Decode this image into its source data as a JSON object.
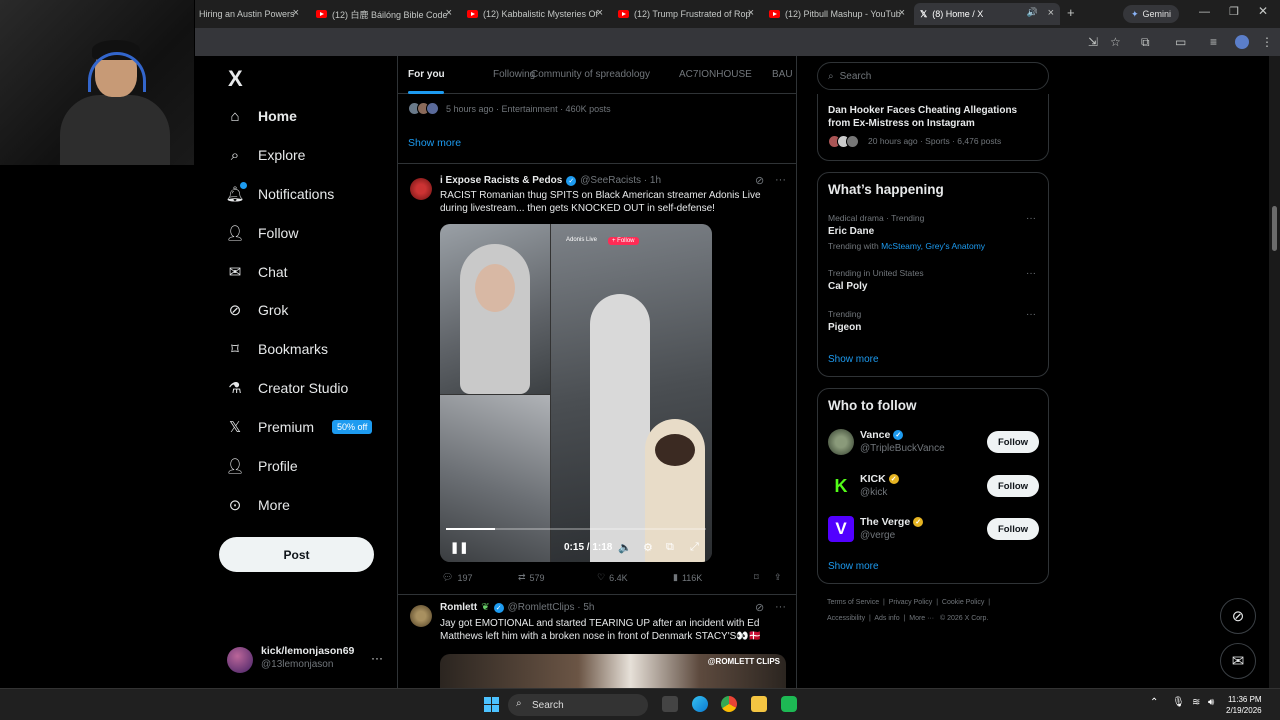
{
  "browser": {
    "tabs": [
      {
        "title": "Hiring an Austin Powers"
      },
      {
        "title": "(12) 白鹿 Báilóng Bible Code"
      },
      {
        "title": "(12) Kabbalistic Mysteries Of"
      },
      {
        "title": "(12) Trump Frustrated of Rop"
      },
      {
        "title": "(12) Pitbull Mashup - YouTub"
      },
      {
        "title": "(8) Home / X"
      }
    ],
    "gemini_label": "Gemini"
  },
  "nav": {
    "logo": "X",
    "items": [
      {
        "label": "Home",
        "icon": "home-icon"
      },
      {
        "label": "Explore",
        "icon": "search-icon"
      },
      {
        "label": "Notifications",
        "icon": "bell-icon"
      },
      {
        "label": "Follow",
        "icon": "person-add-icon"
      },
      {
        "label": "Chat",
        "icon": "mail-icon"
      },
      {
        "label": "Grok",
        "icon": "grok-icon"
      },
      {
        "label": "Bookmarks",
        "icon": "bookmark-icon"
      },
      {
        "label": "Creator Studio",
        "icon": "flask-icon"
      },
      {
        "label": "Premium",
        "icon": "x-icon"
      },
      {
        "label": "Profile",
        "icon": "person-icon"
      },
      {
        "label": "More",
        "icon": "more-circle-icon"
      }
    ],
    "premium_badge": "50% off",
    "post_label": "Post",
    "account": {
      "name": "kick/lemonjason69",
      "handle": "@13lemonjason"
    }
  },
  "timeline": {
    "tabs": [
      "For you",
      "Following",
      "Community of spreadology",
      "AC7IONHOUSE",
      "BAU"
    ],
    "trend_meta": "5 hours ago · Entertainment · 460K posts",
    "show_more": "Show more",
    "tweets": [
      {
        "name": "i Expose Racists & Pedos",
        "handle": "@SeeRacists · 1h",
        "text": "RACIST Romanian thug SPITS on Black American streamer Adonis Live during livestream... then gets KNOCKED OUT in self-defense!",
        "video": {
          "time": "0:15 / 1:18",
          "progress": 0.19,
          "live_label": "Adonis Live",
          "follow_label": "+ Follow"
        },
        "stats": {
          "replies": "197",
          "reposts": "579",
          "likes": "6.4K",
          "views": "116K"
        }
      },
      {
        "name": "Romlett",
        "handle": "@RomlettClips · 5h",
        "text": "Jay got EMOTIONAL and started TEARING UP after an incident with Ed Matthews left him with a broken nose in front of Denmark STACY'S👀🇩🇰",
        "image_label": "@ROMLETT CLIPS"
      }
    ]
  },
  "right": {
    "search_placeholder": "Search",
    "top_trend": {
      "title": "Dan Hooker Faces Cheating Allegations from Ex-Mistress on Instagram",
      "meta": "20 hours ago · Sports · 6,476 posts"
    },
    "happening": {
      "title": "What’s happening",
      "items": [
        {
          "context": "Medical drama · Trending",
          "name": "Eric Dane",
          "extra_prefix": "Trending with",
          "extra": "McSteamy, Grey's Anatomy"
        },
        {
          "context": "Trending in United States",
          "name": "Cal Poly"
        },
        {
          "context": "Trending",
          "name": "Pigeon"
        }
      ],
      "show_more": "Show more"
    },
    "who_to_follow": {
      "title": "Who to follow",
      "accounts": [
        {
          "name": "Vance",
          "handle": "@TripleBuckVance",
          "button": "Follow"
        },
        {
          "name": "KICK",
          "handle": "@kick",
          "button": "Follow"
        },
        {
          "name": "The Verge",
          "handle": "@verge",
          "button": "Follow"
        }
      ],
      "show_more": "Show more"
    },
    "footer": {
      "line1": [
        "Terms of Service",
        "Privacy Policy",
        "Cookie Policy"
      ],
      "line2": [
        "Accessibility",
        "Ads info",
        "More ···",
        "© 2026 X Corp."
      ]
    }
  },
  "taskbar": {
    "search": "Search",
    "time": "11:36 PM",
    "date": "2/19/2026"
  },
  "colors": {
    "accent": "#1d9bf0",
    "border": "#2f3336",
    "muted": "#71767b"
  }
}
